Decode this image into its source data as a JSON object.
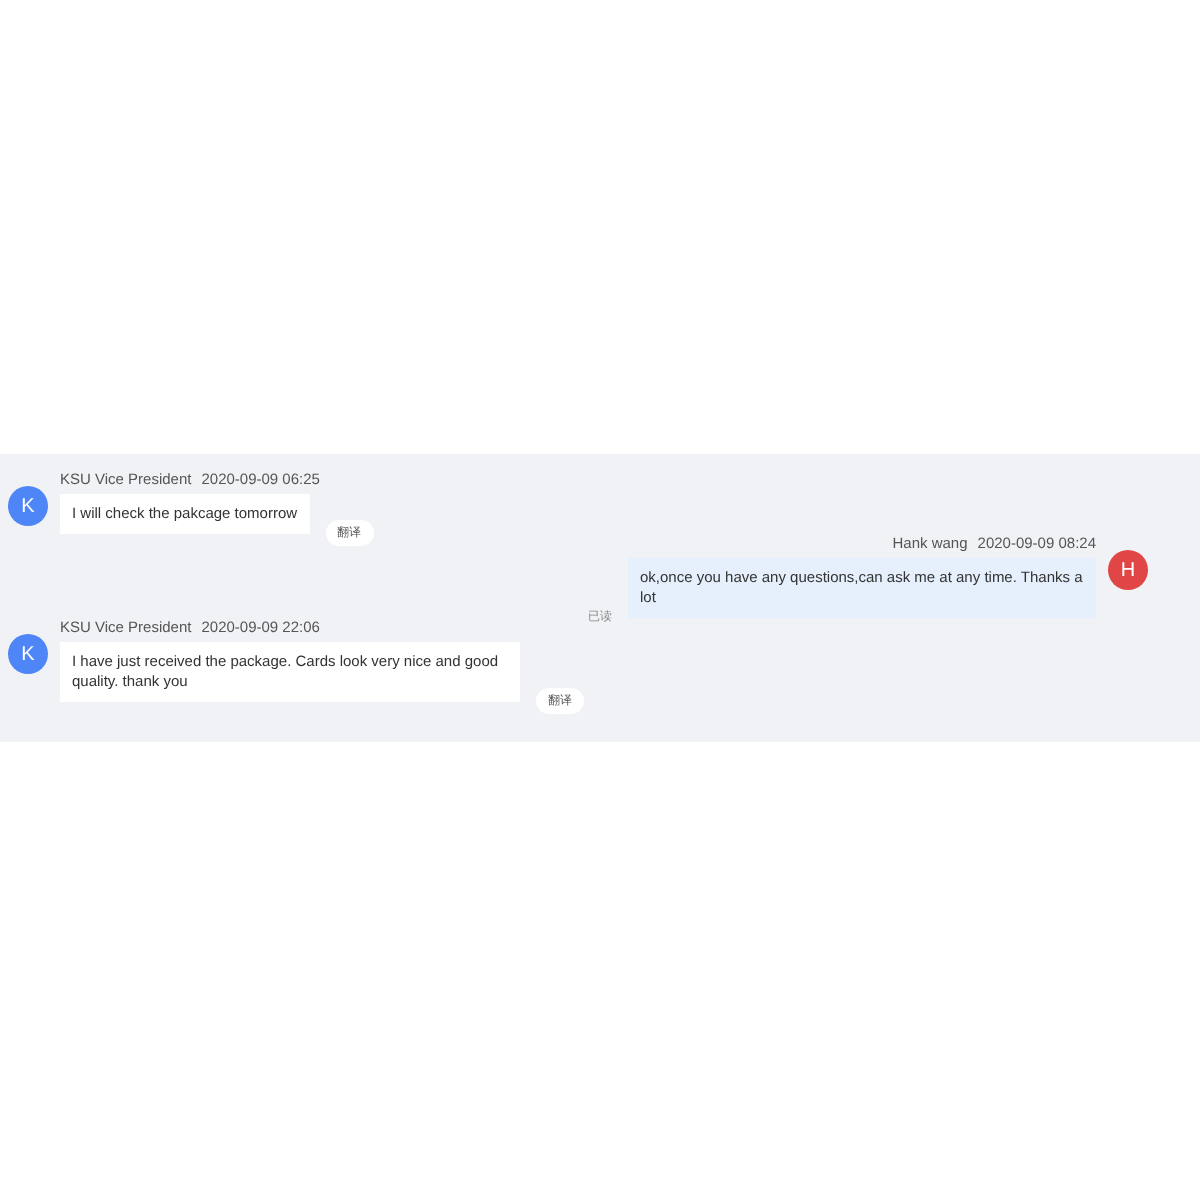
{
  "messages": [
    {
      "kind": "in",
      "avatar": "K",
      "color": "#4f86f7",
      "sender": "KSU Vice President",
      "time": "2020-09-09 06:25",
      "text": "I will check the pakcage tomorrow",
      "action": "翻译"
    },
    {
      "kind": "out",
      "avatar": "H",
      "color": "#e04646",
      "sender": "Hank wang",
      "time": "2020-09-09 08:24",
      "text": "ok,once you have any questions,can ask me at any time. Thanks a lot",
      "status": "已读"
    },
    {
      "kind": "in",
      "avatar": "K",
      "color": "#4f86f7",
      "sender": "KSU Vice President",
      "time": "2020-09-09 22:06",
      "text": "I have just received the package. Cards look very nice and good quality. thank you",
      "action": "翻译"
    }
  ]
}
